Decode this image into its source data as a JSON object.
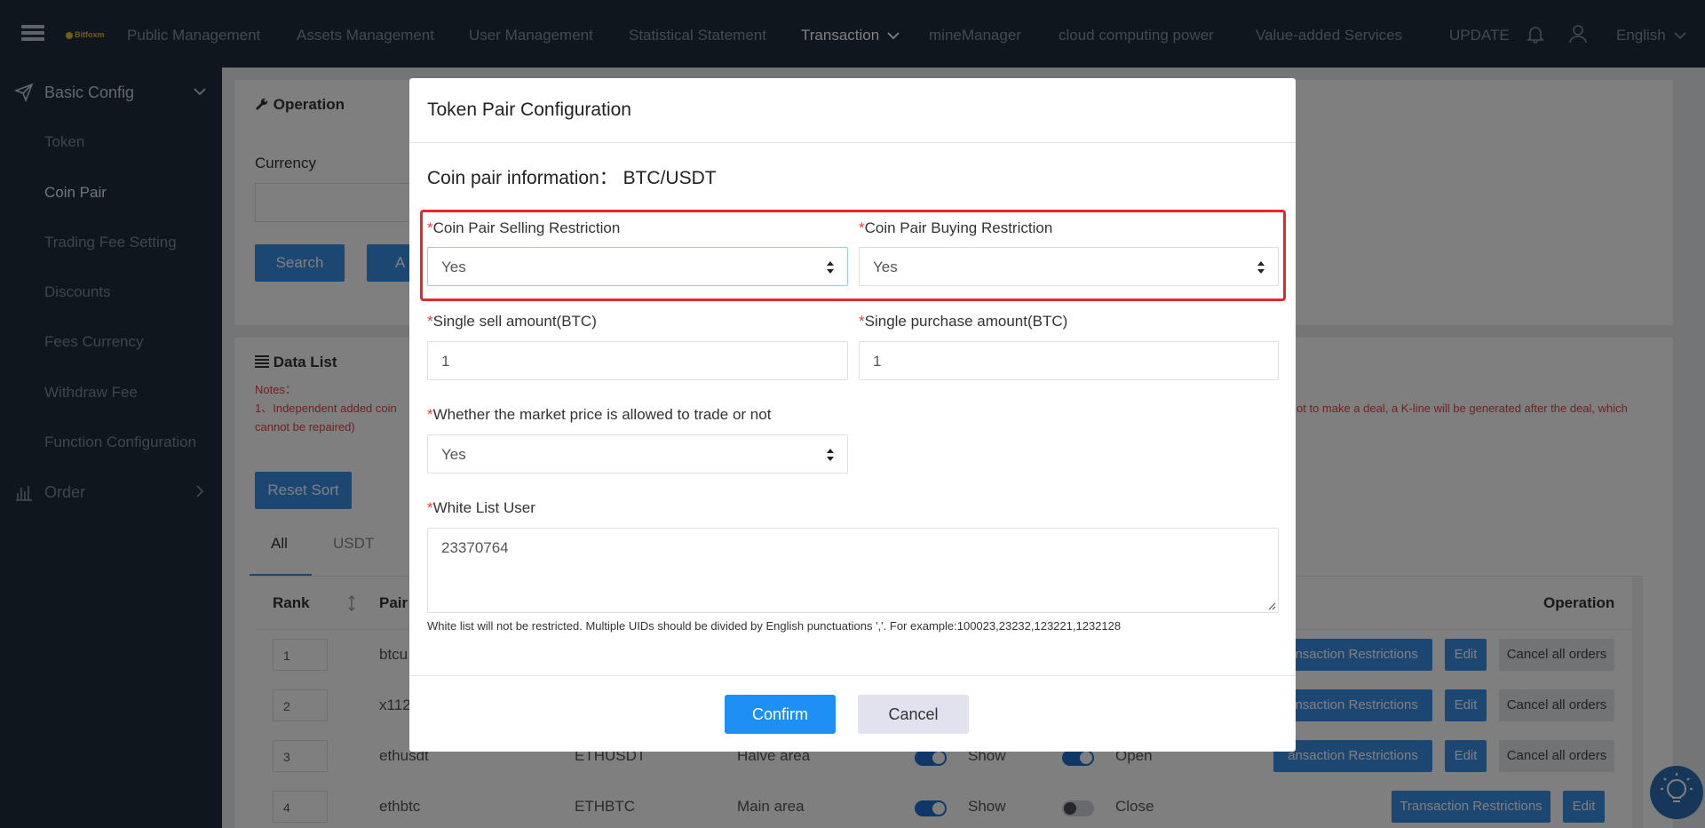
{
  "topnav": {
    "logo": "Bitfoxm",
    "items": [
      "Public Management",
      "Assets Management",
      "User Management",
      "Statistical Statement",
      "Transaction",
      "mineManager",
      "cloud computing power",
      "Value-added Services"
    ],
    "update": "UPDATE",
    "language": "English"
  },
  "sidebar": {
    "group1": "Basic Config",
    "items": [
      "Token",
      "Coin Pair",
      "Trading Fee Setting",
      "Discounts",
      "Fees Currency",
      "Withdraw Fee",
      "Function Configuration"
    ],
    "group2": "Order"
  },
  "operation": {
    "title": "Operation",
    "currency_label": "Currency",
    "search": "Search",
    "add_partial": "A"
  },
  "datalist": {
    "title": "Data List",
    "notes_label": "Notes：",
    "note_left": "1、Independent added coin",
    "note_left2": "cannot be repaired)",
    "note_right": "ot to make a deal, a K-line will be generated after the deal, which",
    "reset_sort": "Reset Sort",
    "tabs": [
      "All",
      "USDT"
    ],
    "headers": {
      "rank": "Rank",
      "pairs": "Pair",
      "operation": "Operation"
    },
    "rows": [
      {
        "rank": "1",
        "pair": "btcu",
        "symbol": "",
        "area": "",
        "show": "",
        "open": ""
      },
      {
        "rank": "2",
        "pair": "x112",
        "symbol": "",
        "area": "",
        "show": "",
        "open": ""
      },
      {
        "rank": "3",
        "pair": "ethusdt",
        "symbol": "ETHUSDT",
        "area": "Halve area",
        "show": "Show",
        "open": "Open"
      },
      {
        "rank": "4",
        "pair": "ethbtc",
        "symbol": "ETHBTC",
        "area": "Main area",
        "show": "Show",
        "open": "Close"
      }
    ],
    "btn_restrict_partial": "ansaction Restrictions",
    "btn_restrict": "Transaction Restrictions",
    "btn_edit": "Edit",
    "btn_cancel_orders": "Cancel all orders"
  },
  "modal": {
    "title": "Token Pair Configuration",
    "pair_info": "Coin pair information： BTC/USDT",
    "sell_restrict_label": "Coin Pair Selling Restriction",
    "sell_restrict_value": "Yes",
    "buy_restrict_label": "Coin Pair Buying Restriction",
    "buy_restrict_value": "Yes",
    "single_sell_label": "Single sell amount(BTC)",
    "single_sell_value": "1",
    "single_buy_label": "Single purchase amount(BTC)",
    "single_buy_value": "1",
    "market_label": "Whether the market price is allowed to trade or not",
    "market_value": "Yes",
    "whitelist_label": "White List User",
    "whitelist_value": "23370764",
    "whitelist_hint": "White list will not be restricted. Multiple UIDs should be divided by English punctuations ','. For example:100023,23232,123221,1232128",
    "required_mark": "*",
    "confirm": "Confirm",
    "cancel": "Cancel"
  }
}
